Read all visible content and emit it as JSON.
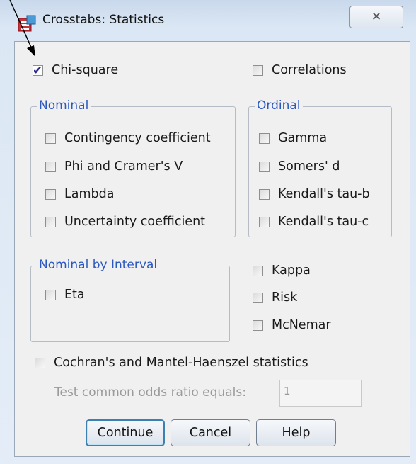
{
  "window": {
    "title": "Crosstabs: Statistics",
    "close_glyph": "✕"
  },
  "chi_square": {
    "label": "Chi-square",
    "checked": true
  },
  "correlations": {
    "label": "Correlations",
    "checked": false
  },
  "nominal": {
    "title": "Nominal",
    "items": [
      {
        "label": "Contingency coefficient",
        "checked": false
      },
      {
        "label": "Phi and Cramer's V",
        "checked": false
      },
      {
        "label": "Lambda",
        "checked": false
      },
      {
        "label": "Uncertainty coefficient",
        "checked": false
      }
    ]
  },
  "ordinal": {
    "title": "Ordinal",
    "items": [
      {
        "label": "Gamma",
        "checked": false
      },
      {
        "label": "Somers' d",
        "checked": false
      },
      {
        "label": "Kendall's tau-b",
        "checked": false
      },
      {
        "label": "Kendall's tau-c",
        "checked": false
      }
    ]
  },
  "nominal_by_interval": {
    "title": "Nominal by Interval",
    "items": [
      {
        "label": "Eta",
        "checked": false
      }
    ]
  },
  "other": {
    "items": [
      {
        "label": "Kappa",
        "checked": false
      },
      {
        "label": "Risk",
        "checked": false
      },
      {
        "label": "McNemar",
        "checked": false
      }
    ]
  },
  "cmh": {
    "label": "Cochran's and Mantel-Haenszel statistics",
    "checked": false
  },
  "odds": {
    "label": "Test common odds ratio equals:",
    "value": "1"
  },
  "buttons": {
    "continue": "Continue",
    "cancel": "Cancel",
    "help": "Help"
  },
  "colors": {
    "group_title": "#2b58c0",
    "check": "#2a2a8a"
  }
}
